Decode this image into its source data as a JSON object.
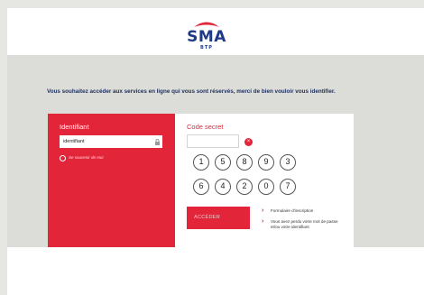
{
  "brand": {
    "name": "SMA",
    "sub": "BTP",
    "arc_color": "#e3253a",
    "text_color": "#1f3a86"
  },
  "intro_text": "Vous souhaitez accéder aux services en ligne qui vous sont réservés, merci de bien vouloir vous identifier.",
  "login": {
    "identifier_title": "Identifiant",
    "identifier_value": "identifiant",
    "lock_icon": "lock-icon",
    "remember_label": "Se souvenir de moi",
    "secret_title": "Code secret",
    "clear_icon": "close-icon",
    "clear_glyph": "×",
    "keypad": {
      "row1": [
        "1",
        "5",
        "8",
        "9",
        "3"
      ],
      "row2": [
        "6",
        "4",
        "2",
        "0",
        "7"
      ]
    },
    "submit_label": "ACCÉDER",
    "links": [
      "Formulaire d'inscription",
      "Vous avez perdu votre mot de passe et/ou votre identifiant"
    ],
    "chevron_glyph": "›"
  },
  "colors": {
    "accent_red": "#e3253a",
    "background_gray": "#dcdcd8"
  }
}
